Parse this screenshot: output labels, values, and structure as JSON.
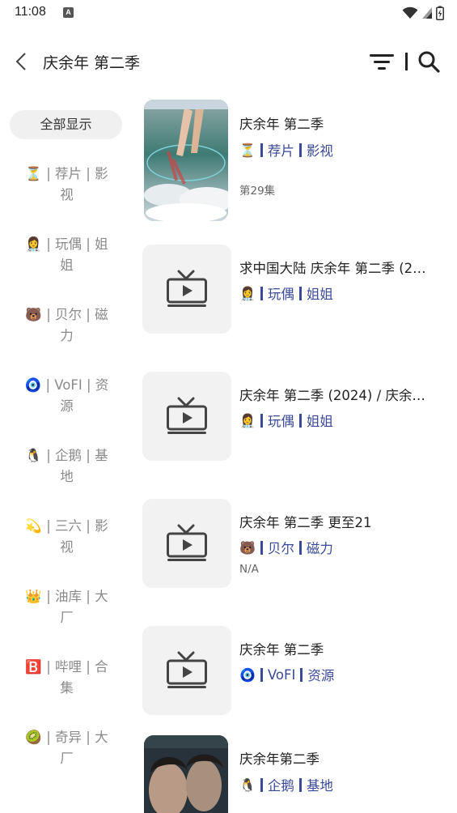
{
  "status_bar": {
    "time": "11:08",
    "notification_glyph": "A"
  },
  "header": {
    "title": "庆余年 第二季"
  },
  "sidebar": {
    "all_label": "全部显示",
    "items": [
      {
        "emoji": "⏳",
        "line1": "⏳ | 荐片 | 影",
        "line2": "视"
      },
      {
        "emoji": "👩",
        "line1": "👩‍⚕️ | 玩偶 | 姐",
        "line2": "姐"
      },
      {
        "emoji": "🐻",
        "line1": "🐻 | 贝尔 | 磁",
        "line2": "力"
      },
      {
        "emoji": "🧿",
        "line1": "🧿 | VoFI | 资",
        "line2": "源"
      },
      {
        "emoji": "🐧",
        "line1": "🐧 | 企鹅 | 基",
        "line2": "地"
      },
      {
        "emoji": "💫",
        "line1": "💫 | 三六 | 影",
        "line2": "视"
      },
      {
        "emoji": "👑",
        "line1": "👑 | 油库 | 大",
        "line2": "厂"
      },
      {
        "emoji": "🅱",
        "line1": "🅱️ | 哔哩 | 合",
        "line2": "集"
      },
      {
        "emoji": "🥝",
        "line1": "🥝 | 奇异 | 大",
        "line2": "厂"
      }
    ]
  },
  "results": [
    {
      "title": "庆余年 第二季",
      "emoji": "⏳",
      "tag1": "荐片",
      "tag2": "影视",
      "note": "第29集",
      "thumb": "poster-feet"
    },
    {
      "title": "求中国大陆 庆余年 第二季 (2…",
      "emoji": "👩‍⚕️",
      "tag1": "玩偶",
      "tag2": "姐姐",
      "note": "",
      "thumb": "tv-placeholder"
    },
    {
      "title": "庆余年 第二季 (2024) / 庆余…",
      "emoji": "👩‍⚕️",
      "tag1": "玩偶",
      "tag2": "姐姐",
      "note": "",
      "thumb": "tv-placeholder"
    },
    {
      "title": "庆余年 第二季 更至21",
      "emoji": "🐻",
      "tag1": "贝尔",
      "tag2": "磁力",
      "note": "N/A",
      "thumb": "tv-placeholder"
    },
    {
      "title": "庆余年 第二季",
      "emoji": "🧿",
      "tag1": "VoFI",
      "tag2": "资源",
      "note": "",
      "thumb": "tv-placeholder"
    },
    {
      "title": "庆余年第二季",
      "emoji": "🐧",
      "tag1": "企鹅",
      "tag2": "基地",
      "note": "",
      "thumb": "poster-portrait"
    }
  ],
  "colors": {
    "accent": "#3a4a99",
    "sidebar_text": "#8a8a8a",
    "chip_bg": "#f0f0f0",
    "thumb_bg": "#f2f2f2"
  }
}
